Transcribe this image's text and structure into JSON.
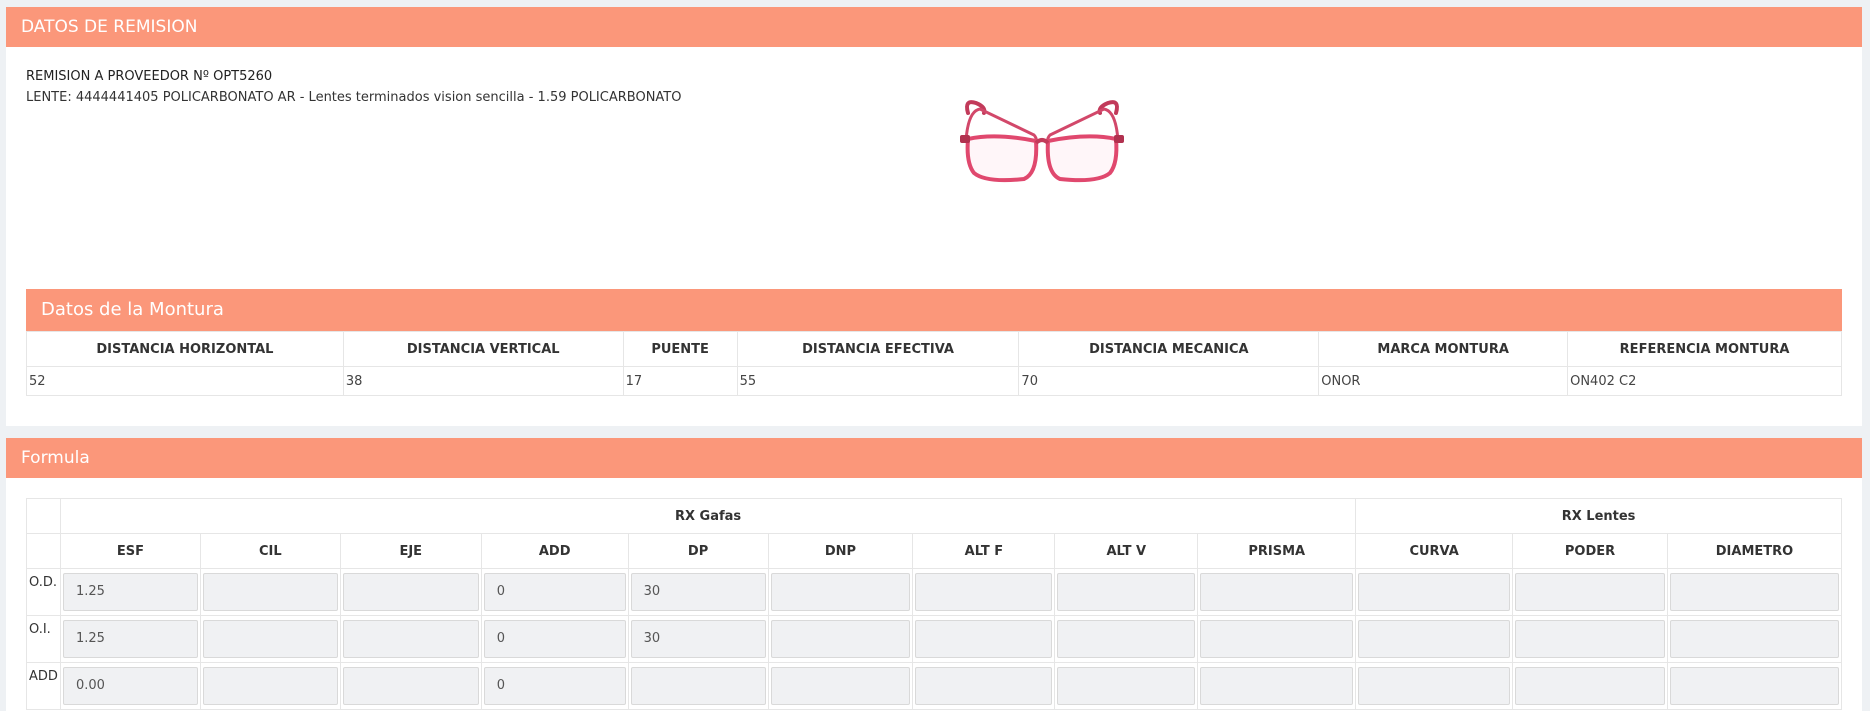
{
  "remision_card": {
    "title": "DATOS DE REMISION",
    "line1": "REMISION A PROVEEDOR Nº OPT5260",
    "line2": "LENTE: 4444441405 POLICARBONATO AR - Lentes terminados vision sencilla - 1.59 POLICARBONATO",
    "frame_image": "red-eyeglasses-frame"
  },
  "montura": {
    "title": "Datos de la Montura",
    "headers": [
      "DISTANCIA HORIZONTAL",
      "DISTANCIA VERTICAL",
      "PUENTE",
      "DISTANCIA EFECTIVA",
      "DISTANCIA MECANICA",
      "MARCA MONTURA",
      "REFERENCIA MONTURA"
    ],
    "values": [
      "52",
      "38",
      "17",
      "55",
      "70",
      "ONOR",
      "ON402 C2"
    ]
  },
  "formula": {
    "title": "Formula",
    "group_gafas": "RX Gafas",
    "group_lentes": "RX Lentes",
    "columns": [
      "ESF",
      "CIL",
      "EJE",
      "ADD",
      "DP",
      "DNP",
      "ALT F",
      "ALT V",
      "PRISMA",
      "CURVA",
      "PODER",
      "DIAMETRO"
    ],
    "rows": [
      {
        "label": "O.D.",
        "values": [
          "1.25",
          "",
          "",
          "0",
          "30",
          "",
          "",
          "",
          "",
          "",
          "",
          ""
        ]
      },
      {
        "label": "O.I.",
        "values": [
          "1.25",
          "",
          "",
          "0",
          "30",
          "",
          "",
          "",
          "",
          "",
          "",
          ""
        ]
      },
      {
        "label": "ADD",
        "values": [
          "0.00",
          "",
          "",
          "0",
          "",
          "",
          "",
          "",
          "",
          "",
          "",
          ""
        ]
      }
    ]
  },
  "colors": {
    "accent": "#fb977a",
    "field_bg": "#f0f1f3",
    "page_bg": "#eef1f4"
  }
}
